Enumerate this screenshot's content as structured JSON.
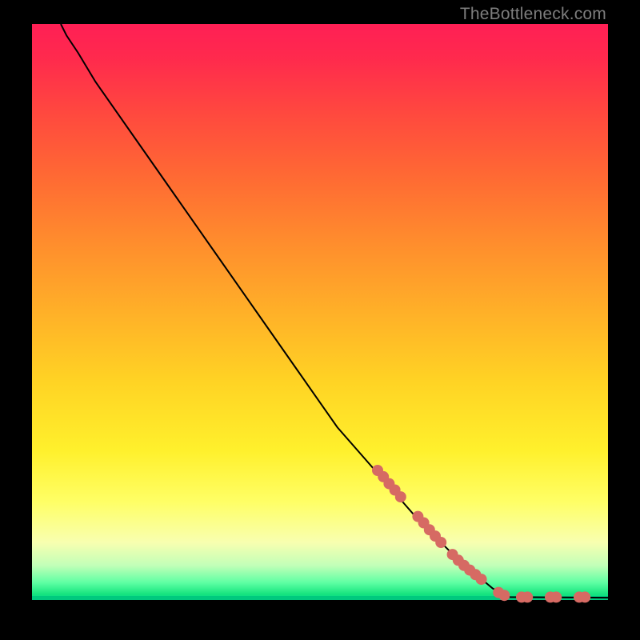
{
  "watermark": "TheBottleneck.com",
  "chart_data": {
    "type": "line",
    "title": "",
    "xlabel": "",
    "ylabel": "",
    "xlim": [
      0,
      100
    ],
    "ylim": [
      0,
      100
    ],
    "curve": [
      {
        "x": 5,
        "y": 100
      },
      {
        "x": 6,
        "y": 98
      },
      {
        "x": 8,
        "y": 95
      },
      {
        "x": 11,
        "y": 90
      },
      {
        "x": 18,
        "y": 80
      },
      {
        "x": 25,
        "y": 70
      },
      {
        "x": 32,
        "y": 60
      },
      {
        "x": 39,
        "y": 50
      },
      {
        "x": 46,
        "y": 40
      },
      {
        "x": 53,
        "y": 30
      },
      {
        "x": 60,
        "y": 22
      },
      {
        "x": 67,
        "y": 14
      },
      {
        "x": 74,
        "y": 7
      },
      {
        "x": 80,
        "y": 2
      },
      {
        "x": 83,
        "y": 0.5
      },
      {
        "x": 100,
        "y": 0.4
      }
    ],
    "points": [
      {
        "x": 60,
        "y": 22.5
      },
      {
        "x": 61,
        "y": 21.4
      },
      {
        "x": 62,
        "y": 20.2
      },
      {
        "x": 63,
        "y": 19.1
      },
      {
        "x": 64,
        "y": 17.9
      },
      {
        "x": 67,
        "y": 14.5
      },
      {
        "x": 68,
        "y": 13.4
      },
      {
        "x": 69,
        "y": 12.2
      },
      {
        "x": 70,
        "y": 11.1
      },
      {
        "x": 71,
        "y": 10.0
      },
      {
        "x": 73,
        "y": 7.9
      },
      {
        "x": 74,
        "y": 6.9
      },
      {
        "x": 75,
        "y": 6.0
      },
      {
        "x": 76,
        "y": 5.2
      },
      {
        "x": 77,
        "y": 4.4
      },
      {
        "x": 78,
        "y": 3.6
      },
      {
        "x": 81,
        "y": 1.3
      },
      {
        "x": 82,
        "y": 0.8
      },
      {
        "x": 85,
        "y": 0.5
      },
      {
        "x": 86,
        "y": 0.5
      },
      {
        "x": 90,
        "y": 0.5
      },
      {
        "x": 91,
        "y": 0.5
      },
      {
        "x": 95,
        "y": 0.5
      },
      {
        "x": 96,
        "y": 0.5
      }
    ],
    "gradient_stops": [
      {
        "pos": 0,
        "color": "#ff1f55"
      },
      {
        "pos": 50,
        "color": "#ffb028"
      },
      {
        "pos": 83,
        "color": "#ffff66"
      },
      {
        "pos": 97,
        "color": "#5effa3"
      },
      {
        "pos": 100,
        "color": "#00d98f"
      }
    ]
  },
  "colors": {
    "frame_bg": "#000000",
    "dot": "#d66a63",
    "curve": "#000000",
    "watermark": "#7d7d7d"
  }
}
